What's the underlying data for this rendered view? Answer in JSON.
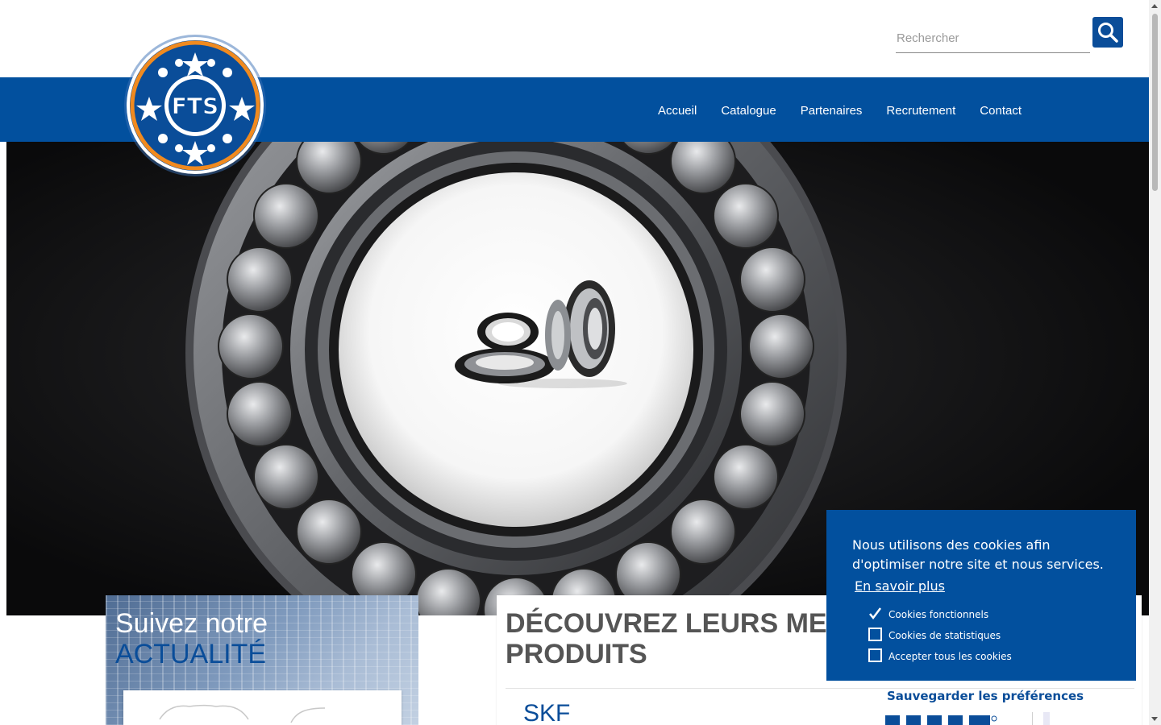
{
  "search": {
    "placeholder": "Rechercher",
    "icon": "search-icon"
  },
  "nav": {
    "items": [
      {
        "label": "Accueil"
      },
      {
        "label": "Catalogue"
      },
      {
        "label": "Partenaires"
      },
      {
        "label": "Recrutement"
      },
      {
        "label": "Contact"
      }
    ]
  },
  "logo": {
    "text": "FTS"
  },
  "news": {
    "line1": "Suivez notre",
    "line2": "ACTUALITÉ"
  },
  "products": {
    "title": "DÉCOUVREZ LEURS MEILLEURS PRODUITS",
    "brand": "SKF"
  },
  "cookie": {
    "message": "Nous utilisons des cookies afin d'optimiser notre site et nous services.",
    "learn_more": "En savoir plus",
    "options": [
      {
        "label": "Cookies fonctionnels",
        "checked": true
      },
      {
        "label": "Cookies de statistiques",
        "checked": false
      },
      {
        "label": "Accepter tous les cookies",
        "checked": false
      }
    ],
    "save_label": "Sauvegarder les préférences"
  },
  "colors": {
    "brand_blue": "#02509e",
    "accent_orange": "#f08a1f",
    "white": "#ffffff"
  }
}
